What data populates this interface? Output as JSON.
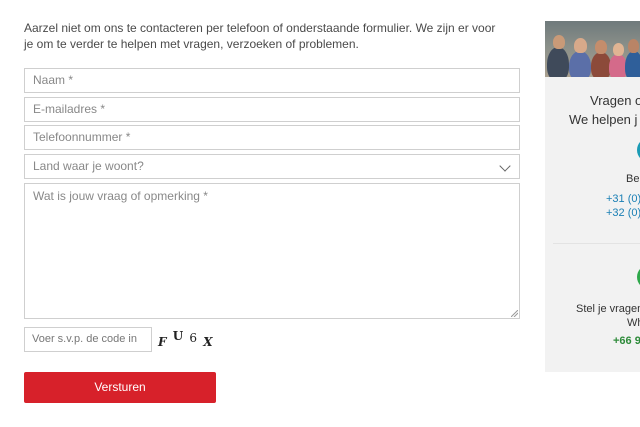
{
  "intro": "Aarzel niet om ons te contacteren per telefoon of onderstaande formulier. We zijn er voor je om te verder te helpen met vragen, verzoeken of problemen.",
  "form": {
    "name_placeholder": "Naam *",
    "email_placeholder": "E-mailadres *",
    "phone_placeholder": "Telefoonnummer *",
    "country_selected": "Land waar je woont?",
    "message_placeholder": "Wat is jouw vraag of opmerking *",
    "captcha_placeholder": "Voer s.v.p. de code in",
    "captcha_chars": [
      "F",
      "U",
      "6",
      "X"
    ],
    "submit_label": "Versturen"
  },
  "sidebar": {
    "title_line1": "Vragen o",
    "title_line2": "We helpen j",
    "call_label": "Bel",
    "phone_nl": "+31 (0)",
    "phone_be": "+32 (0)",
    "whatsapp_text1": "Stel je vragen",
    "whatsapp_text2": "Wh",
    "whatsapp_phone": "+66 9"
  },
  "colors": {
    "submit": "#d7212a",
    "call_icon": "#1a9bb5",
    "whatsapp_icon": "#2ea84a",
    "link_blue": "#1a7fb5",
    "whatsapp_green": "#2e8b3a"
  }
}
